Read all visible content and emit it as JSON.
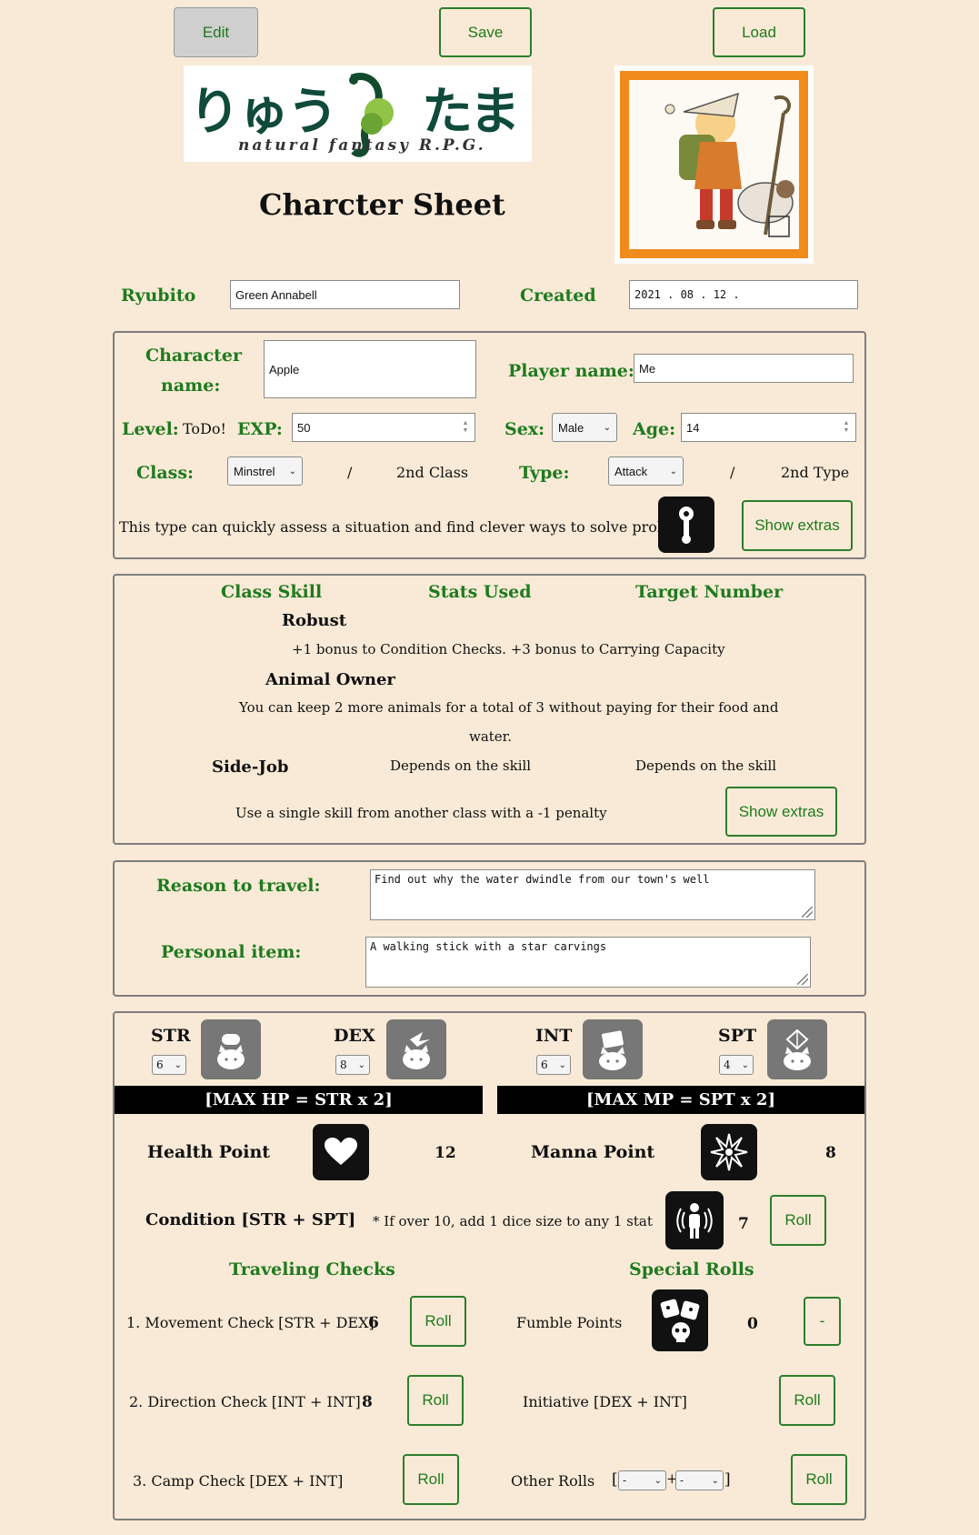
{
  "toolbar": {
    "edit": "Edit",
    "save": "Save",
    "load": "Load"
  },
  "logo": {
    "kana_left": "りゅう",
    "kana_right": "たま",
    "tagline": "natural fantasy R.P.G."
  },
  "page_title": "Charcter Sheet",
  "header": {
    "ryubito_label": "Ryubito",
    "ryubito_value": "Green Annabell",
    "created_label": "Created",
    "created_value": "2021 .  08 .  12 ."
  },
  "character": {
    "name_label_1": "Character",
    "name_label_2": "name:",
    "name_value": "Apple",
    "player_label": "Player name:",
    "player_value": "Me",
    "level_label": "Level:",
    "level_value": "ToDo!",
    "exp_label": "EXP:",
    "exp_value": "50",
    "sex_label": "Sex:",
    "sex_value": "Male",
    "age_label": "Age:",
    "age_value": "14",
    "class_label": "Class:",
    "class_value": "Minstrel",
    "slash": "/",
    "second_class": "2nd Class",
    "type_label": "Type:",
    "type_value": "Attack",
    "second_type": "2nd Type",
    "type_desc": "This type can quickly assess a situation and find clever ways to solve problems.",
    "show_extras": "Show extras"
  },
  "skills": {
    "col_skill": "Class Skill",
    "col_stats": "Stats Used",
    "col_target": "Target Number",
    "items": [
      {
        "name": "Robust",
        "desc": "+1 bonus to Condition Checks. +3 bonus to Carrying Capacity"
      },
      {
        "name": "Animal Owner",
        "desc_1": "You can keep 2 more animals for a total of 3 without paying for their food and",
        "desc_2": "water."
      },
      {
        "name": "Side-Job",
        "stats": "Depends on the skill",
        "target": "Depends on the skill",
        "desc": "Use a single skill from another class with a -1 penalty"
      }
    ],
    "show_extras": "Show extras"
  },
  "travel": {
    "reason_label": "Reason to travel:",
    "reason_value": "Find out why the water dwindle from our town's well",
    "item_label": "Personal item:",
    "item_value": "A walking stick with a star carvings"
  },
  "stats": {
    "str_label": "STR",
    "str_value": "6",
    "dex_label": "DEX",
    "dex_value": "8",
    "int_label": "INT",
    "int_value": "6",
    "spt_label": "SPT",
    "spt_value": "4",
    "max_hp": "[MAX HP = STR x 2]",
    "max_mp": "[MAX MP = SPT x 2]",
    "hp_label": "Health Point",
    "hp_value": "12",
    "mp_label": "Manna Point",
    "mp_value": "8",
    "condition_label": "Condition [STR + SPT]",
    "condition_note": "* If over 10, add 1 dice size to any 1 stat",
    "condition_value": "7",
    "roll": "Roll",
    "traveling_title": "Traveling Checks",
    "special_title": "Special Rolls",
    "movement_label": "1. Movement Check [STR + DEX]",
    "movement_value": "6",
    "direction_label": "2. Direction Check [INT + INT]",
    "direction_value": "8",
    "camp_label": "3. Camp Check [DEX + INT]",
    "fumble_label": "Fumble Points",
    "fumble_value": "0",
    "fumble_button": "-",
    "initiative_label": "Initiative [DEX + INT]",
    "other_label": "Other Rolls",
    "other_a": "-",
    "other_b": "-",
    "bracket_open": "[",
    "plus": "+",
    "bracket_close": "]"
  }
}
